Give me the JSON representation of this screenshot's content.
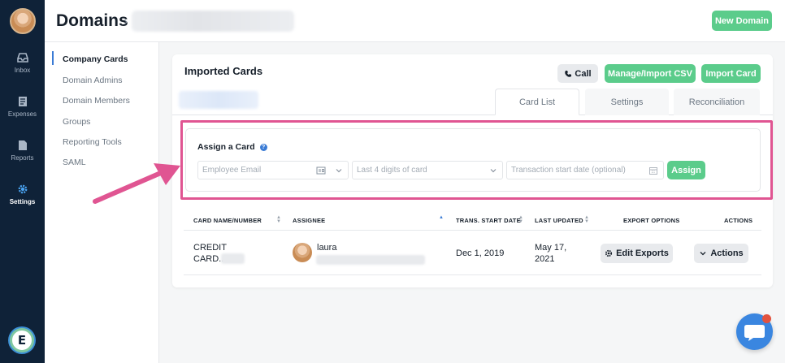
{
  "nav": {
    "items": [
      {
        "label": "Inbox",
        "icon": "inbox-icon"
      },
      {
        "label": "Expenses",
        "icon": "receipt-icon"
      },
      {
        "label": "Reports",
        "icon": "document-icon"
      },
      {
        "label": "Settings",
        "icon": "gear-icon",
        "active": true
      }
    ]
  },
  "header": {
    "title": "Domains",
    "new_domain_label": "New Domain"
  },
  "subnav": {
    "items": [
      "Company Cards",
      "Domain Admins",
      "Domain Members",
      "Groups",
      "Reporting Tools",
      "SAML"
    ]
  },
  "card": {
    "title": "Imported Cards",
    "call_label": "Call",
    "manage_label": "Manage/Import CSV",
    "import_label": "Import Card",
    "tabs": [
      "Card List",
      "Settings",
      "Reconciliation"
    ]
  },
  "assign": {
    "title": "Assign a Card",
    "employee_placeholder": "Employee Email",
    "last4_placeholder": "Last 4 digits of card",
    "date_placeholder": "Transaction start date (optional)",
    "assign_label": "Assign"
  },
  "table": {
    "headers": [
      "CARD NAME/NUMBER",
      "ASSIGNEE",
      "TRANS. START DATE",
      "LAST UPDATED",
      "EXPORT OPTIONS",
      "ACTIONS"
    ],
    "row": {
      "card_line1": "CREDIT",
      "card_line2": "CARD..",
      "assignee": "laura",
      "start_date": "Dec 1, 2019",
      "updated_line1": "May 17,",
      "updated_line2": "2021",
      "edit_exports_label": "Edit Exports",
      "actions_label": "Actions"
    }
  },
  "colors": {
    "accent_green": "#5bcc8b",
    "highlight_pink": "#e05592",
    "rail_navy": "#0f2238",
    "link_blue": "#3a7bd5"
  }
}
